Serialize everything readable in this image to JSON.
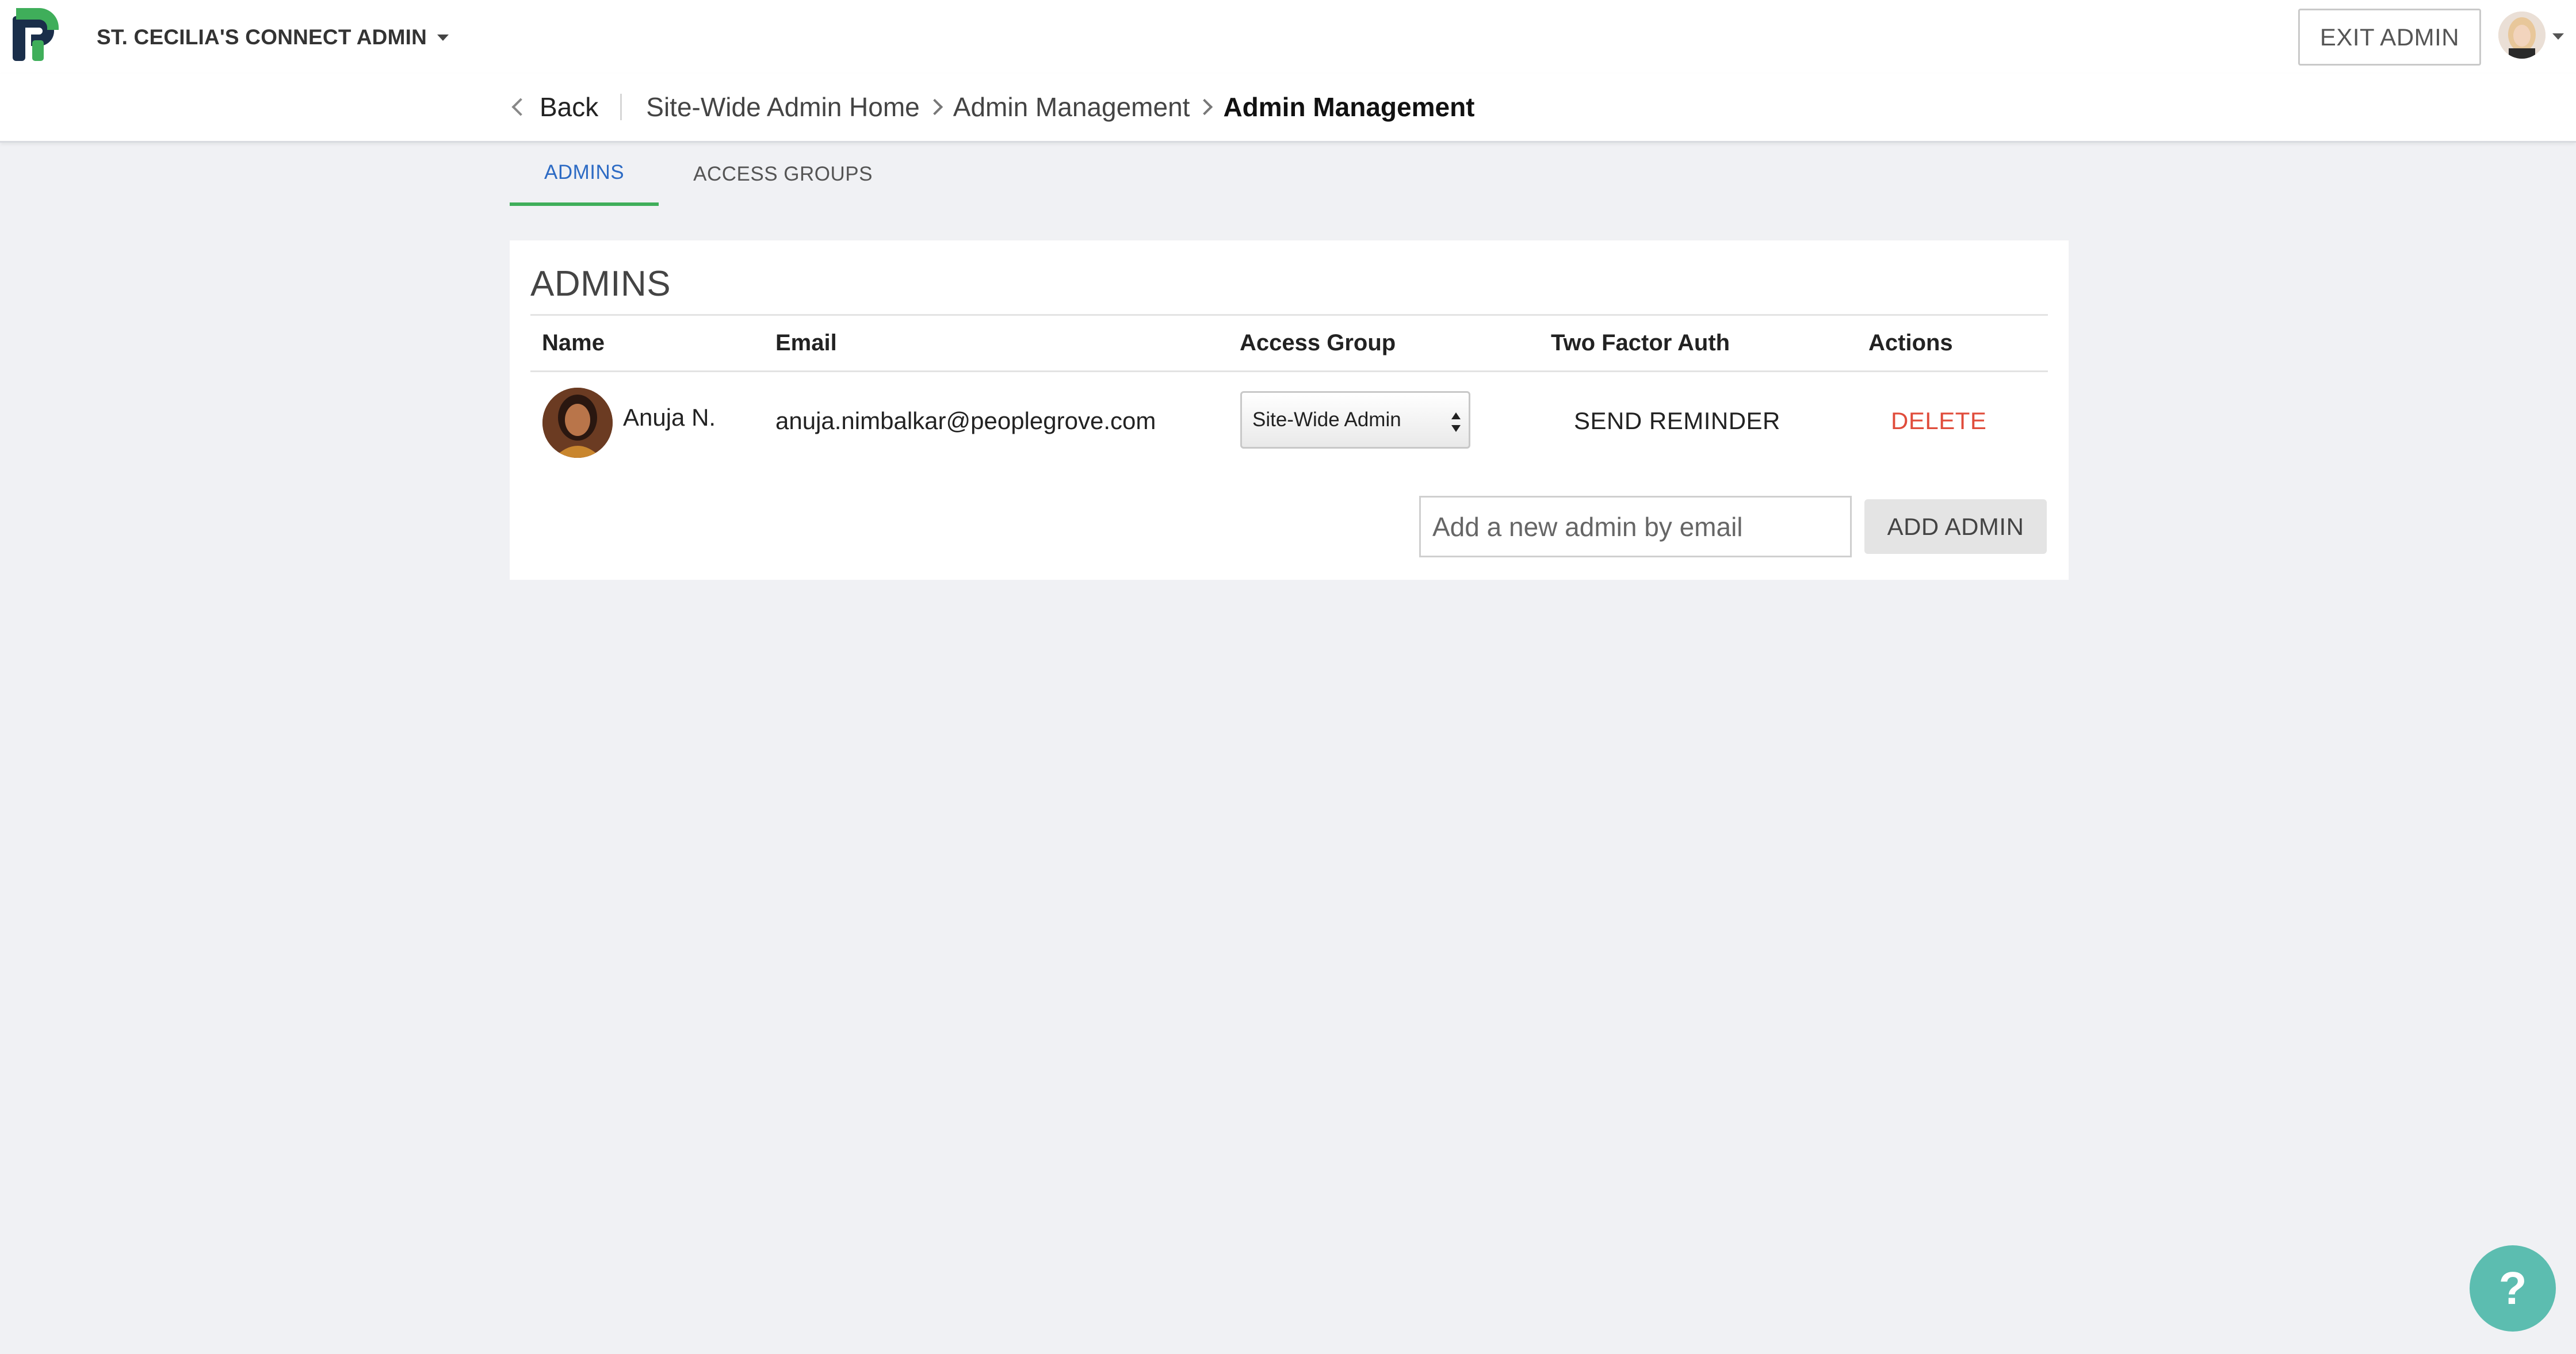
{
  "header": {
    "site_name": "ST. CECILIA'S CONNECT ADMIN",
    "exit_label": "EXIT ADMIN",
    "brand_colors": {
      "primary": "#1a2e4a",
      "accent": "#3fae5a"
    }
  },
  "breadcrumb": {
    "back_label": "Back",
    "items": [
      "Site-Wide Admin Home",
      "Admin Management"
    ],
    "current": "Admin Management"
  },
  "tabs": [
    {
      "label": "ADMINS",
      "active": true
    },
    {
      "label": "ACCESS GROUPS",
      "active": false
    }
  ],
  "admins": {
    "title": "ADMINS",
    "columns": [
      "Name",
      "Email",
      "Access Group",
      "Two Factor Auth",
      "Actions"
    ],
    "rows": [
      {
        "name": "Anuja N.",
        "email": "anuja.nimbalkar@peoplegrove.com",
        "access_group": "Site-Wide Admin",
        "two_factor_action": "SEND REMINDER",
        "action": "DELETE"
      }
    ],
    "add_placeholder": "Add a new admin by email",
    "add_button": "ADD ADMIN"
  },
  "help": {
    "label": "?"
  }
}
